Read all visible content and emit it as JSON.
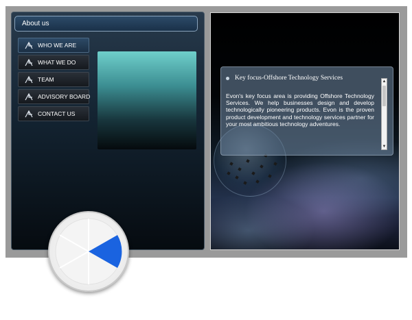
{
  "header": {
    "title": "About  us"
  },
  "menu": {
    "items": [
      {
        "label": "WHO WE ARE",
        "active": true
      },
      {
        "label": "WHAT WE  DO",
        "active": false
      },
      {
        "label": "TEAM",
        "active": false
      },
      {
        "label": "ADVISORY BOARD",
        "active": false
      },
      {
        "label": "CONTACT US",
        "active": false
      }
    ],
    "icon": "menu-arrow-icon"
  },
  "info": {
    "title": "Key focus-Offshore Technology Services",
    "body": "Evon's key focus area is providing Offshore Technology Services. We help businesses design and develop technologically pioneering products. Evon is the proven product development and technology services partner for your most ambitious technology adventures."
  },
  "dial": {
    "active_color": "#1a63e0"
  },
  "colors": {
    "frame": "#9a9a9a",
    "accent": "#1a63e0"
  }
}
